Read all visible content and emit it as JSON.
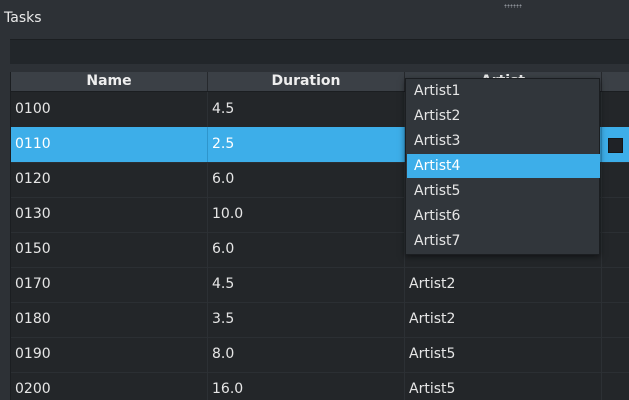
{
  "panel": {
    "title": "Tasks"
  },
  "table": {
    "columns": [
      "Name",
      "Duration",
      "Artist"
    ],
    "rows": [
      {
        "name": "0100",
        "duration": "4.5",
        "artist": ""
      },
      {
        "name": "0110",
        "duration": "2.5",
        "artist": ""
      },
      {
        "name": "0120",
        "duration": "6.0",
        "artist": ""
      },
      {
        "name": "0130",
        "duration": "10.0",
        "artist": ""
      },
      {
        "name": "0150",
        "duration": "6.0",
        "artist": ""
      },
      {
        "name": "0170",
        "duration": "4.5",
        "artist": "Artist2"
      },
      {
        "name": "0180",
        "duration": "3.5",
        "artist": "Artist2"
      },
      {
        "name": "0190",
        "duration": "8.0",
        "artist": "Artist5"
      },
      {
        "name": "0200",
        "duration": "16.0",
        "artist": "Artist5"
      }
    ],
    "selected_row_index": 1
  },
  "dropdown": {
    "options": [
      "Artist1",
      "Artist2",
      "Artist3",
      "Artist4",
      "Artist5",
      "Artist6",
      "Artist7"
    ],
    "highlighted": "Artist4"
  },
  "colors": {
    "selection": "#3daee9",
    "background": "#232629",
    "header": "#3b4046"
  },
  "icons": {
    "grip": "drag-handle-icon",
    "checkbox": "checkbox-icon"
  }
}
